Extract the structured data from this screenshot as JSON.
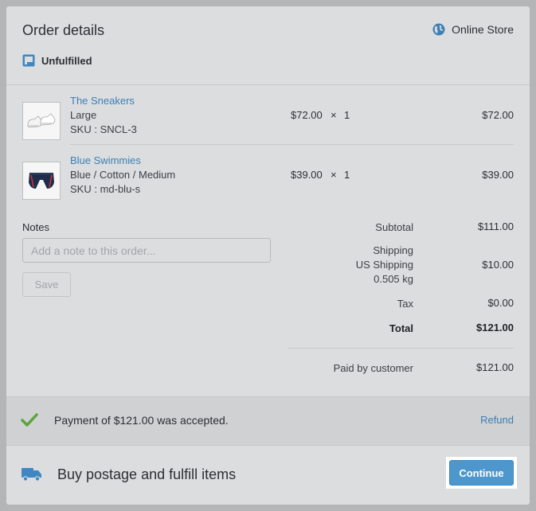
{
  "header": {
    "title": "Order details",
    "channel": "Online Store",
    "status": "Unfulfilled"
  },
  "items": [
    {
      "name": "The Sneakers",
      "variant": "Large",
      "sku": "SKU : SNCL-3",
      "unit_price": "$72.00",
      "times": "×",
      "quantity": "1",
      "line_total": "$72.00"
    },
    {
      "name": "Blue Swimmies",
      "variant": "Blue / Cotton / Medium",
      "sku": "SKU : md-blu-s",
      "unit_price": "$39.00",
      "times": "×",
      "quantity": "1",
      "line_total": "$39.00"
    }
  ],
  "notes": {
    "label": "Notes",
    "placeholder": "Add a note to this order...",
    "save_label": "Save"
  },
  "summary": {
    "subtotal_label": "Subtotal",
    "subtotal_value": "$111.00",
    "shipping_label": "Shipping",
    "shipping_method": "US Shipping",
    "shipping_weight": "0.505 kg",
    "shipping_value": "$10.00",
    "tax_label": "Tax",
    "tax_value": "$0.00",
    "total_label": "Total",
    "total_value": "$121.00",
    "paid_label": "Paid by customer",
    "paid_value": "$121.00"
  },
  "payment": {
    "message": "Payment of $121.00 was accepted.",
    "refund_label": "Refund"
  },
  "fulfill": {
    "label": "Buy postage and fulfill items",
    "continue_label": "Continue"
  },
  "colors": {
    "link": "#3a7fb6",
    "accent": "#4e97cc",
    "success": "#5aa53f"
  },
  "icons": {
    "channel": "globe-icon",
    "status": "unfulfilled-box-icon",
    "payment": "checkmark-icon",
    "fulfill": "truck-icon"
  }
}
